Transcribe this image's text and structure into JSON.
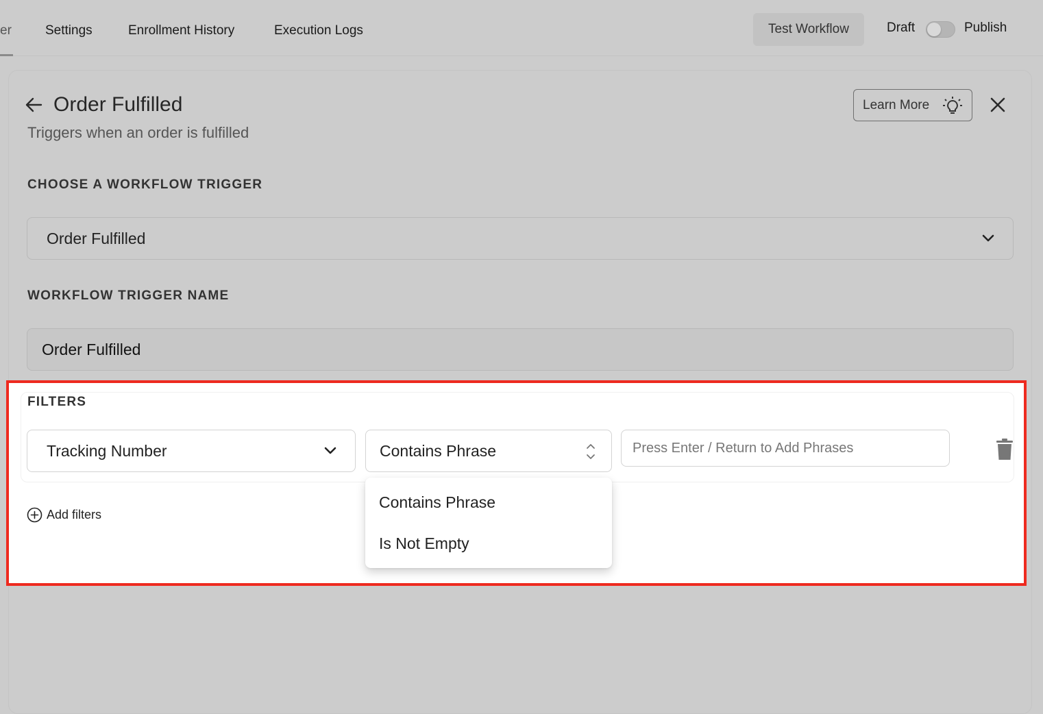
{
  "topbar": {
    "tabs": [
      {
        "label": "er"
      },
      {
        "label": "Settings"
      },
      {
        "label": "Enrollment History"
      },
      {
        "label": "Execution Logs"
      }
    ],
    "test_workflow_label": "Test Workflow",
    "draft_label": "Draft",
    "publish_label": "Publish",
    "publish_toggle_on": false
  },
  "panel": {
    "title": "Order Fulfilled",
    "subtitle": "Triggers when an order is fulfilled",
    "learn_more_label": "Learn More",
    "trigger_section_label": "CHOOSE A WORKFLOW TRIGGER",
    "trigger_value": "Order Fulfilled",
    "name_section_label": "WORKFLOW TRIGGER NAME",
    "name_value": "Order Fulfilled"
  },
  "filters": {
    "label": "FILTERS",
    "field_value": "Tracking Number",
    "operator_value": "Contains Phrase",
    "phrase_placeholder": "Press Enter / Return to Add Phrases",
    "add_label": "Add filters",
    "operator_options": [
      {
        "label": "Contains Phrase"
      },
      {
        "label": "Is Not Empty"
      }
    ]
  },
  "colors": {
    "highlight": "#ee2a1f",
    "overlay_gray": "#cccccc"
  }
}
